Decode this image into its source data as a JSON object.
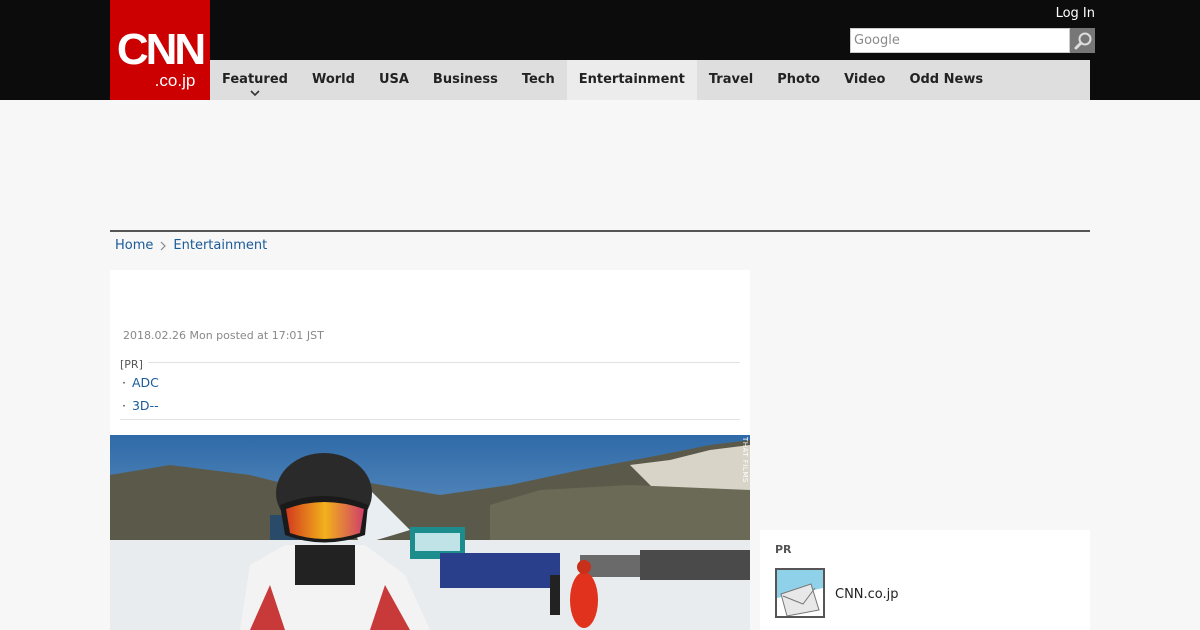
{
  "header": {
    "logo_top": "CNN",
    "logo_bottom": ".co.jp",
    "login_label": "Log In",
    "search_placeholder": "Google"
  },
  "nav": {
    "items": [
      {
        "label": "Featured"
      },
      {
        "label": "World"
      },
      {
        "label": "USA"
      },
      {
        "label": "Business"
      },
      {
        "label": "Tech"
      },
      {
        "label": "Entertainment"
      },
      {
        "label": "Travel"
      },
      {
        "label": "Photo"
      },
      {
        "label": "Video"
      },
      {
        "label": "Odd News"
      }
    ],
    "active": "Entertainment"
  },
  "breadcrumb": {
    "home": "Home",
    "section": "Entertainment"
  },
  "article": {
    "date": "2018.02.26 Mon posted at 17:01 JST",
    "pr_label": "[PR]",
    "pr_links": [
      "ADC",
      "3D--"
    ],
    "photo_credit": "THAT FILMS"
  },
  "sidebar": {
    "pr_title": "PR",
    "pr_item_name": "CNN.co.jp"
  },
  "colors": {
    "brand_red": "#cc0000",
    "topbar": "#0c0c0c",
    "nav_bg": "#dedede",
    "link": "#1a5a9a"
  }
}
